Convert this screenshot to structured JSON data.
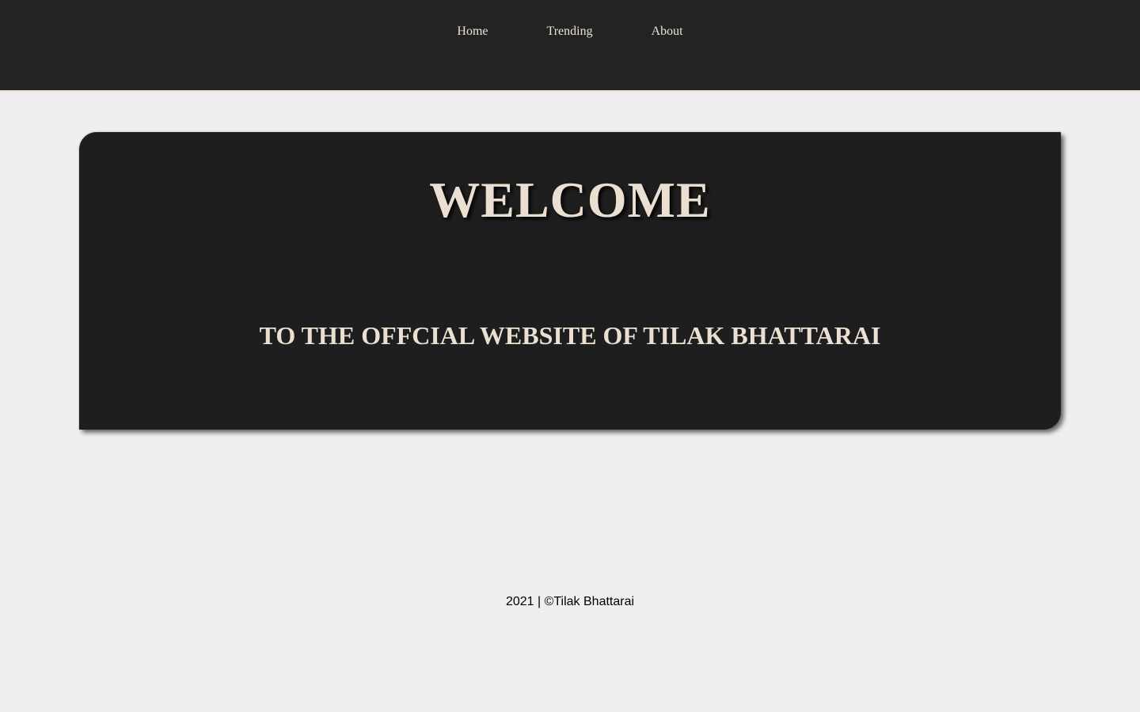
{
  "header": {
    "nav": [
      {
        "label": "Home"
      },
      {
        "label": "Trending"
      },
      {
        "label": "About"
      }
    ]
  },
  "hero": {
    "title": "WELCOME",
    "subtitle": "TO THE OFFCIAL WEBSITE OF TILAK BHATTARAI"
  },
  "footer": {
    "text": "2021 | ©Tilak Bhattarai"
  },
  "colors": {
    "header_bg": "#232323",
    "page_bg": "#f0eeef",
    "hero_bg": "#1e1e1e",
    "accent_text": "#eadfd0"
  }
}
